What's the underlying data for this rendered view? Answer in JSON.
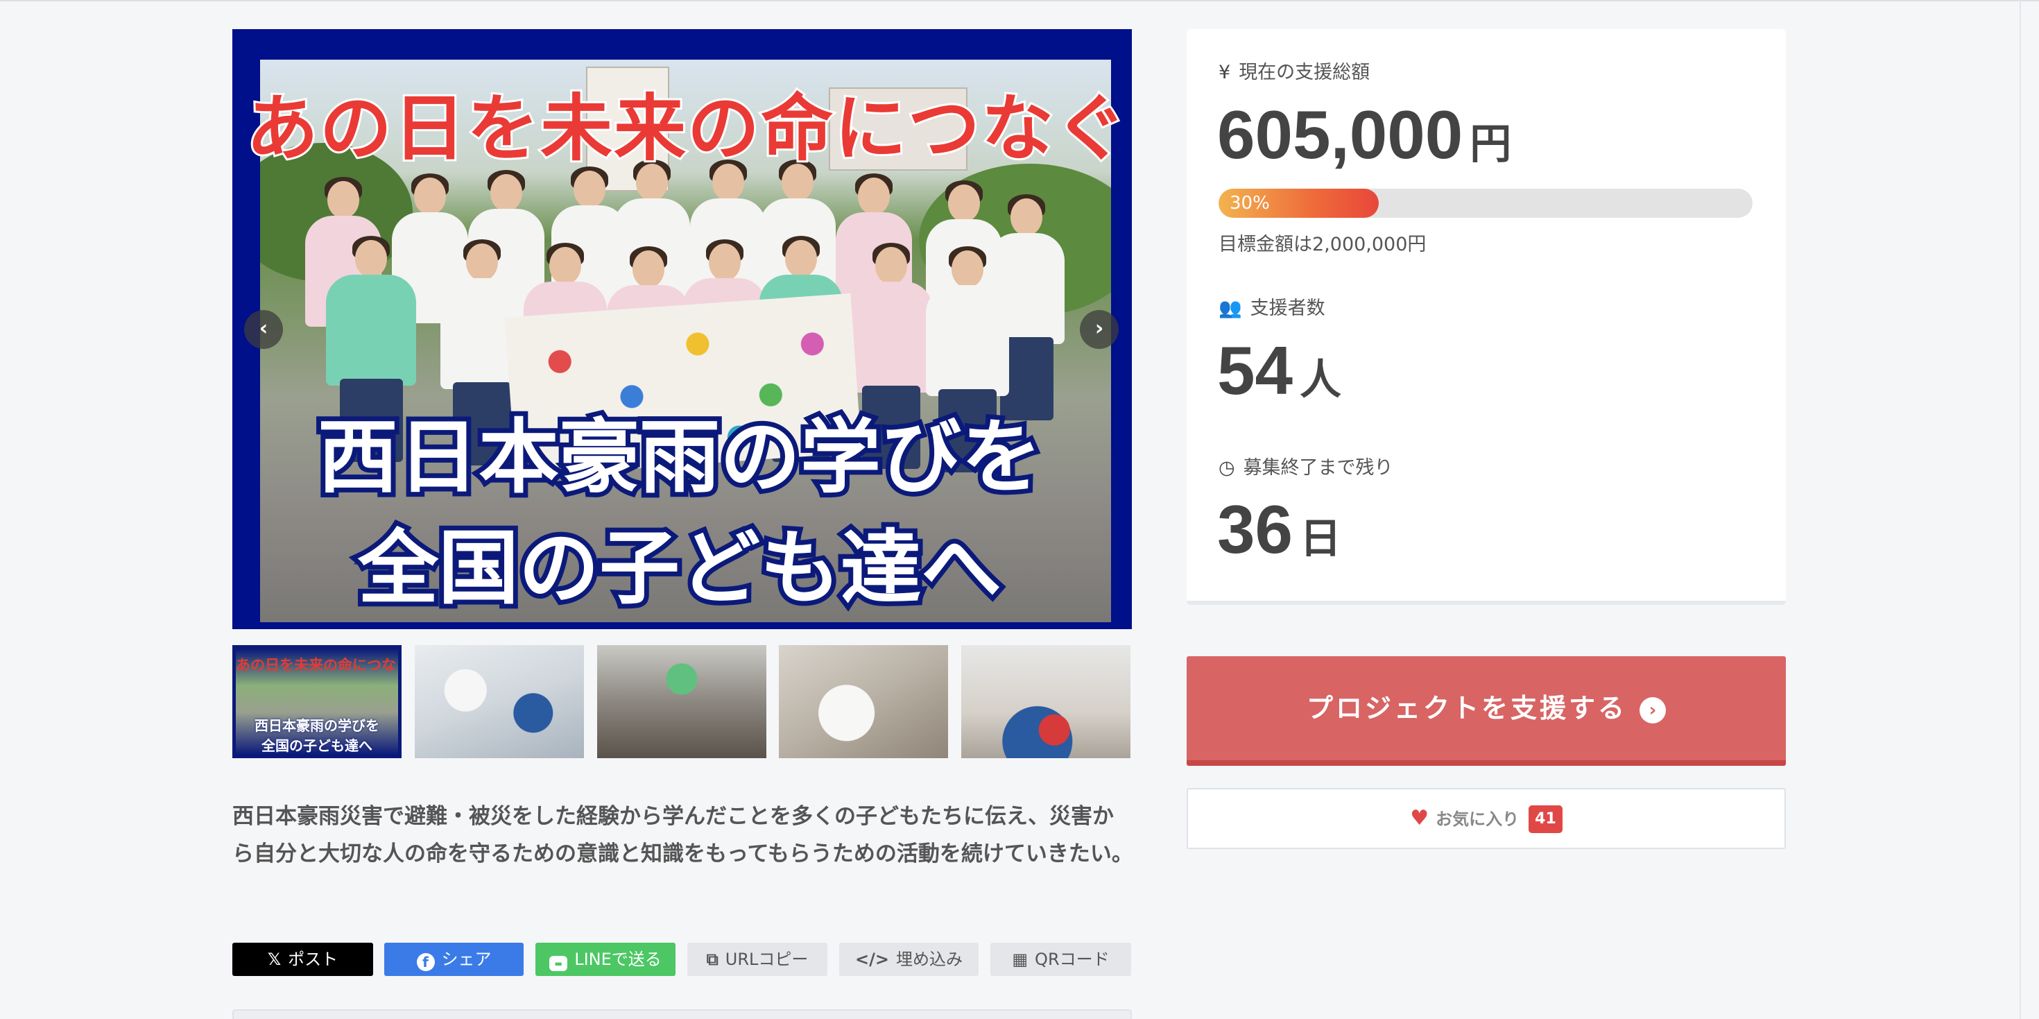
{
  "hero": {
    "headline_top": "あの日を未来の命につなぐ",
    "headline_line1": "西日本豪雨の学びを",
    "headline_line2": "全国の子ども達へ",
    "prev_icon": "chevron-left-icon",
    "next_icon": "chevron-right-icon"
  },
  "thumbnails": {
    "first_top": "あの日を未来の命につなぐ",
    "first_line1": "西日本豪雨の学びを",
    "first_line2": "全国の子ども達へ"
  },
  "description": "西日本豪雨災害で避難・被災をした経験から学んだことを多くの子どもたちに伝え、災害から自分と大切な人の命を守るための意識と知識をもってもらうための活動を続けていきたい。",
  "share": {
    "x": "ポスト",
    "facebook": "シェア",
    "line": "LINEで送る",
    "url": "URLコピー",
    "embed": "埋め込み",
    "qr": "QRコード"
  },
  "stats": {
    "total_label": "現在の支援総額",
    "total_value": "605,000",
    "total_unit": "円",
    "progress_percent": 30,
    "progress_label": "30%",
    "target_text": "目標金額は2,000,000円",
    "supporters_label": "支援者数",
    "supporters_value": "54",
    "supporters_unit": "人",
    "remaining_label": "募集終了まで残り",
    "remaining_value": "36",
    "remaining_unit": "日"
  },
  "actions": {
    "support_label": "プロジェクトを支援する",
    "favorite_label": "お気に入り",
    "favorite_count": "41"
  },
  "colors": {
    "hero_frame": "#000f8a",
    "support_button": "#d86464",
    "favorite_badge": "#e04848",
    "progress_start": "#f3b34f",
    "progress_end": "#e8473a"
  }
}
